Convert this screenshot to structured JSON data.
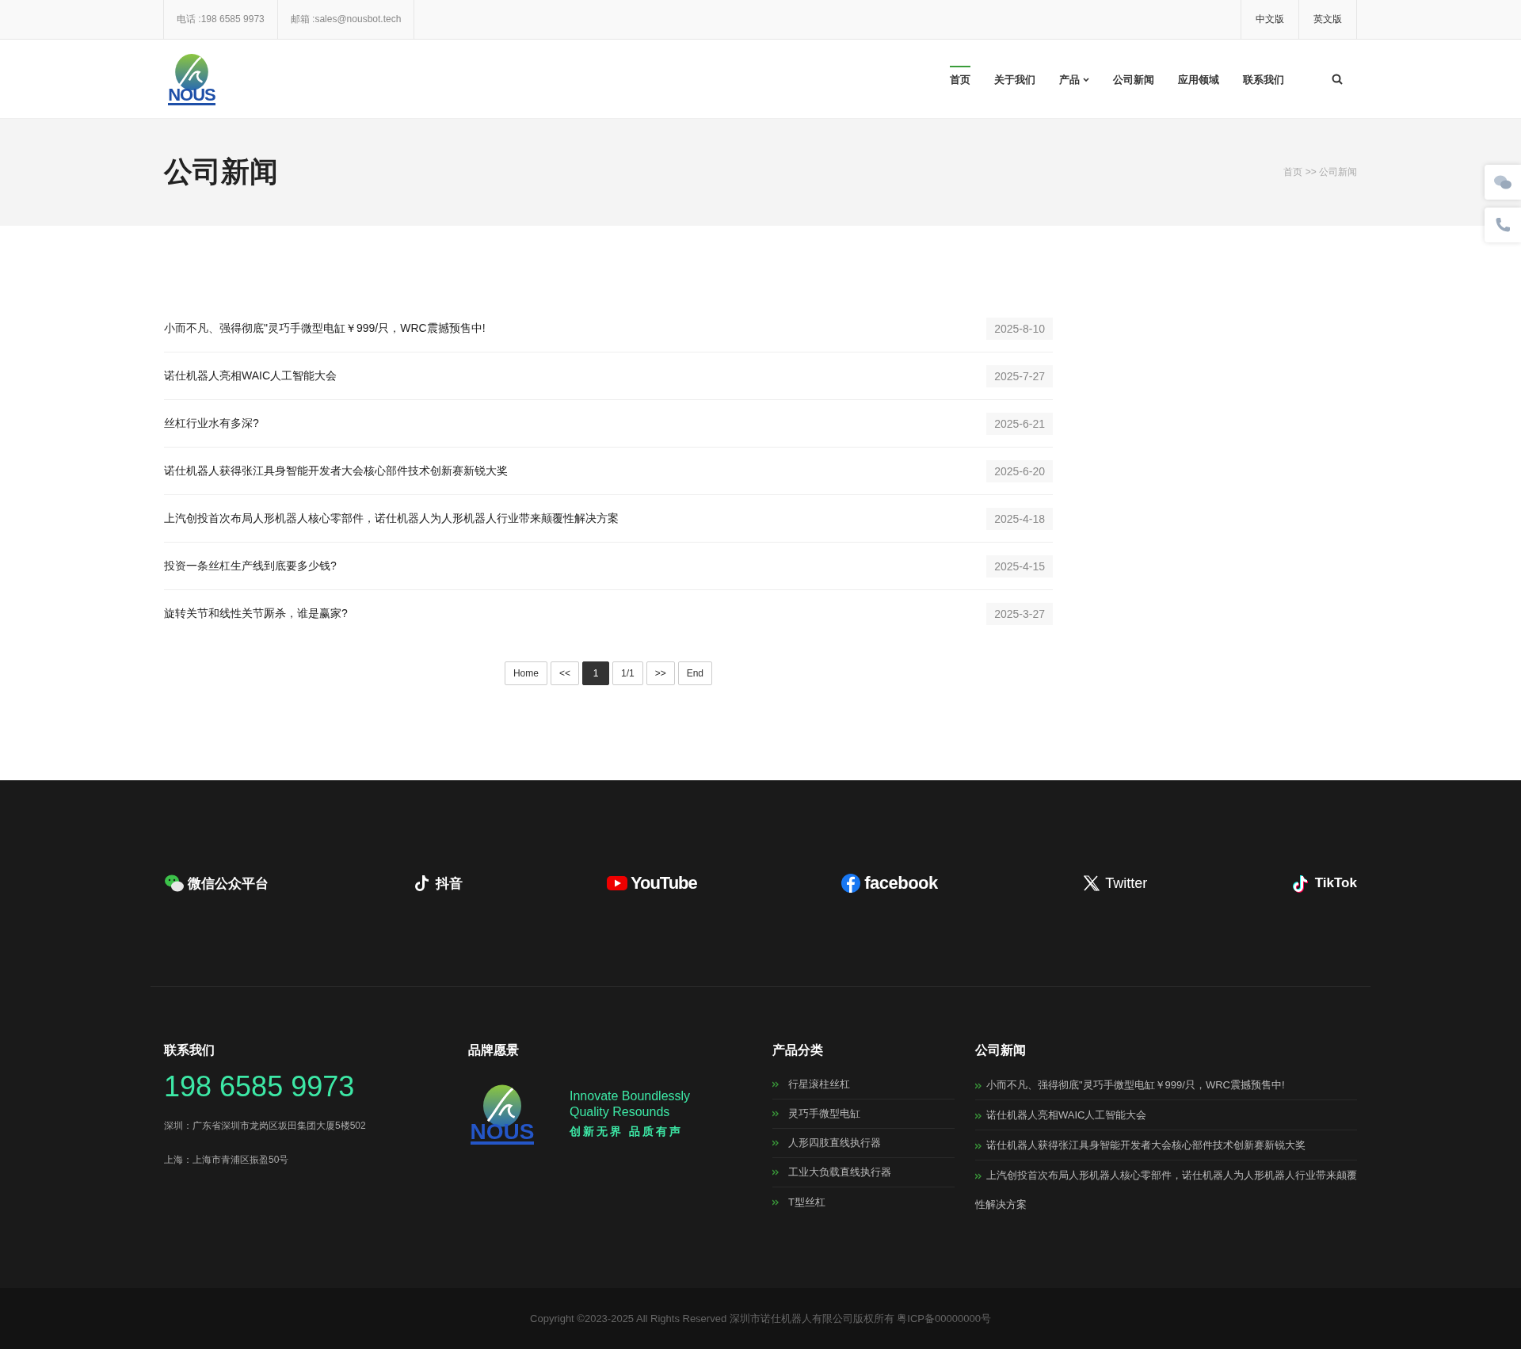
{
  "top_bar": {
    "phone": "电话 :198 6585 9973",
    "email": "邮箱 :sales@nousbot.tech",
    "languages": [
      "中文版",
      "英文版"
    ]
  },
  "logo": {
    "text": "NOUS"
  },
  "nav": [
    {
      "label": "首页",
      "selected": true,
      "has_dropdown": false
    },
    {
      "label": "关于我们",
      "selected": false,
      "has_dropdown": false
    },
    {
      "label": "产品",
      "selected": false,
      "has_dropdown": true
    },
    {
      "label": "公司新闻",
      "selected": false,
      "has_dropdown": false
    },
    {
      "label": "应用领域",
      "selected": false,
      "has_dropdown": false
    },
    {
      "label": "联系我们",
      "selected": false,
      "has_dropdown": false
    }
  ],
  "page_title": "公司新闻",
  "breadcrumb": "首页 >> 公司新闻",
  "side_buttons": [
    {
      "kind": "wechat"
    },
    {
      "kind": "phone"
    }
  ],
  "news": [
    {
      "title": "小而不凡、强得彻底\"灵巧手微型电缸￥999/只，WRC震撼预售中!",
      "date": "2025-8-10"
    },
    {
      "title": "诺仕机器人亮相WAIC人工智能大会",
      "date": "2025-7-27"
    },
    {
      "title": "丝杠行业水有多深?",
      "date": "2025-6-21"
    },
    {
      "title": "诺仕机器人获得张江具身智能开发者大会核心部件技术创新赛新锐大奖",
      "date": "2025-6-20"
    },
    {
      "title": "上汽创投首次布局人形机器人核心零部件，诺仕机器人为人形机器人行业带来颠覆性解决方案",
      "date": "2025-4-18"
    },
    {
      "title": "投资一条丝杠生产线到底要多少钱?",
      "date": "2025-4-15"
    },
    {
      "title": "旋转关节和线性关节厮杀，谁是赢家?",
      "date": "2025-3-27"
    }
  ],
  "pagination": [
    {
      "label": "Home",
      "selected": false
    },
    {
      "label": "<<",
      "selected": false
    },
    {
      "label": "1",
      "selected": true
    },
    {
      "label": "1/1",
      "selected": false
    },
    {
      "label": ">>",
      "selected": false
    },
    {
      "label": "End",
      "selected": false
    }
  ],
  "social": [
    {
      "kind": "wechat",
      "label": "微信公众平台"
    },
    {
      "kind": "douyin",
      "label": "抖音"
    },
    {
      "kind": "youtube",
      "label": "YouTube"
    },
    {
      "kind": "facebook",
      "label": "facebook"
    },
    {
      "kind": "x",
      "label": "Twitter"
    },
    {
      "kind": "tiktok",
      "label": "TikTok"
    }
  ],
  "footer": {
    "contact": {
      "heading": "联系我们",
      "phone": "198 6585 9973",
      "addresses": [
        "深圳：广东省深圳市龙岗区坂田集团大厦5楼502",
        "上海：上海市青浦区振盈50号"
      ]
    },
    "brand": {
      "heading": "品牌愿景",
      "logo_text": "NOUS",
      "slogan_en": [
        "Innovate Boundlessly",
        "Quality Resounds"
      ],
      "slogan_cn": "创新无界 品质有声"
    },
    "products": {
      "heading": "产品分类",
      "items": [
        "行星滚柱丝杠",
        "灵巧手微型电缸",
        "人形四肢直线执行器",
        "工业大负载直线执行器",
        "T型丝杠"
      ]
    },
    "news": {
      "heading": "公司新闻",
      "items": [
        "小而不凡、强得彻底\"灵巧手微型电缸￥999/只，WRC震撼预售中!",
        "诺仕机器人亮相WAIC人工智能大会",
        "诺仕机器人获得张江具身智能开发者大会核心部件技术创新赛新锐大奖",
        "上汽创投首次布局人形机器人核心零部件，诺仕机器人为人形机器人行业带来颠覆性解决方案"
      ]
    }
  },
  "copyright": "Copyright ©2023-2025 All Rights Reserved 深圳市诺仕机器人有限公司版权所有 粤ICP备00000000号"
}
